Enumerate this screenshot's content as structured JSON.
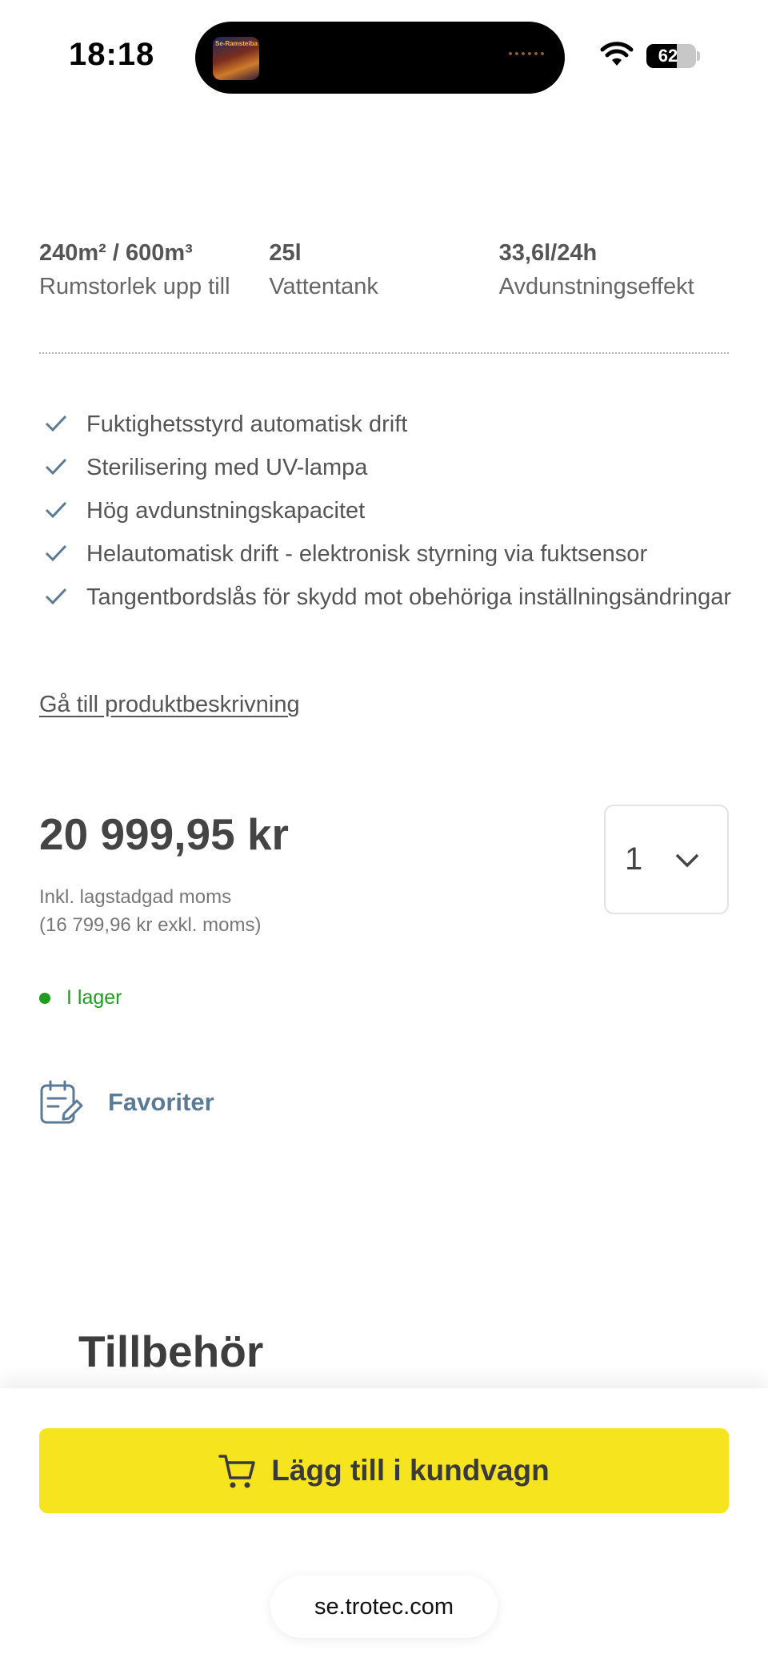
{
  "status_bar": {
    "time": "18:18",
    "battery_level": "62",
    "battery_fraction": 0.62,
    "island_art_text": "Se-Ramsteiba",
    "icons": [
      "wifi-icon",
      "battery-icon"
    ]
  },
  "specs": [
    {
      "value": "240m² / 600m³",
      "label": "Rumstorlek upp till"
    },
    {
      "value": "25l",
      "label": "Vattentank"
    },
    {
      "value": "33,6l/24h",
      "label": "Avdunstningseffekt"
    }
  ],
  "features": [
    "Fuktighetsstyrd automatisk drift",
    "Sterilisering med UV-lampa",
    "Hög avdunstningskapacitet",
    "Helautomatisk drift - elektronisk styrning via fuktsensor",
    "Tangentbordslås för skydd mot obehöriga inställningsändringar"
  ],
  "description_link": "Gå till produktbeskrivning",
  "price": {
    "amount": "20 999,95 kr",
    "vat_note": "Inkl. lagstadgad moms",
    "excl_vat": "(16 799,96 kr exkl. moms)"
  },
  "quantity": {
    "value": "1"
  },
  "stock": {
    "text": "I lager",
    "color": "#1e9e1e"
  },
  "favorites": {
    "label": "Favoriter",
    "color": "#5b7a96"
  },
  "accessories": {
    "title": "Tillbehör"
  },
  "cart": {
    "label": "Lägg till i kundvagn",
    "color": "#f5e41e"
  },
  "browser": {
    "url": "se.trotec.com"
  }
}
